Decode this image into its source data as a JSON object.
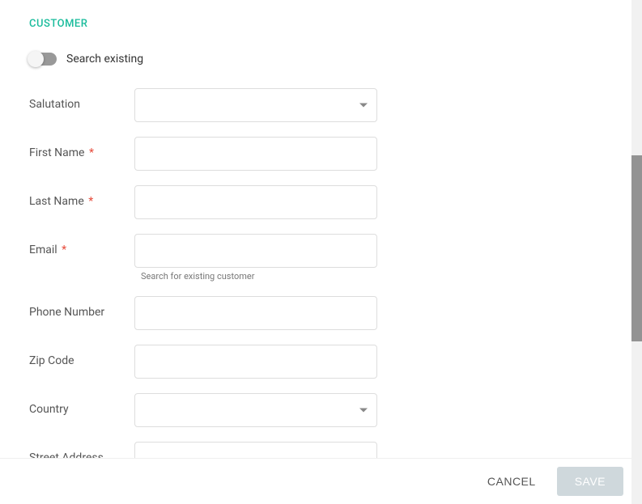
{
  "section": {
    "title": "CUSTOMER"
  },
  "toggle": {
    "label": "Search existing",
    "on": false
  },
  "fields": {
    "salutation": {
      "label": "Salutation",
      "value": "",
      "required": false
    },
    "firstName": {
      "label": "First Name",
      "value": "",
      "required": true
    },
    "lastName": {
      "label": "Last Name",
      "value": "",
      "required": true
    },
    "email": {
      "label": "Email",
      "value": "",
      "required": true,
      "helper": "Search for existing customer"
    },
    "phoneNumber": {
      "label": "Phone Number",
      "value": "",
      "required": false
    },
    "zipCode": {
      "label": "Zip Code",
      "value": "",
      "required": false
    },
    "country": {
      "label": "Country",
      "value": "",
      "required": false
    },
    "streetAddress": {
      "label": "Street Address",
      "value": "",
      "required": false
    }
  },
  "requiredMark": "*",
  "footer": {
    "cancel": "CANCEL",
    "save": "SAVE"
  }
}
